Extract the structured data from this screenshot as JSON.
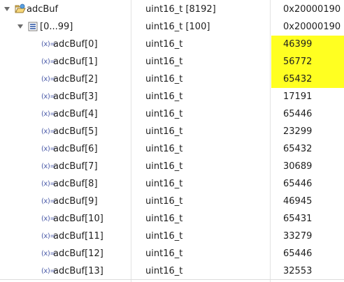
{
  "root": {
    "name": "adcBuf",
    "type": "uint16_t [8192]",
    "value": "0x20000190 <"
  },
  "group": {
    "name": "[0...99]",
    "type": "uint16_t [100]",
    "value": "0x20000190 <"
  },
  "elements": [
    {
      "name": "adcBuf[0]",
      "type": "uint16_t",
      "value": "46399",
      "changed": true
    },
    {
      "name": "adcBuf[1]",
      "type": "uint16_t",
      "value": "56772",
      "changed": true
    },
    {
      "name": "adcBuf[2]",
      "type": "uint16_t",
      "value": "65432",
      "changed": true
    },
    {
      "name": "adcBuf[3]",
      "type": "uint16_t",
      "value": "17191",
      "changed": false
    },
    {
      "name": "adcBuf[4]",
      "type": "uint16_t",
      "value": "65446",
      "changed": false
    },
    {
      "name": "adcBuf[5]",
      "type": "uint16_t",
      "value": "23299",
      "changed": false
    },
    {
      "name": "adcBuf[6]",
      "type": "uint16_t",
      "value": "65432",
      "changed": false
    },
    {
      "name": "adcBuf[7]",
      "type": "uint16_t",
      "value": "30689",
      "changed": false
    },
    {
      "name": "adcBuf[8]",
      "type": "uint16_t",
      "value": "65446",
      "changed": false
    },
    {
      "name": "adcBuf[9]",
      "type": "uint16_t",
      "value": "46945",
      "changed": false
    },
    {
      "name": "adcBuf[10]",
      "type": "uint16_t",
      "value": "65431",
      "changed": false
    },
    {
      "name": "adcBuf[11]",
      "type": "uint16_t",
      "value": "33279",
      "changed": false
    },
    {
      "name": "adcBuf[12]",
      "type": "uint16_t",
      "value": "65446",
      "changed": false
    },
    {
      "name": "adcBuf[13]",
      "type": "uint16_t",
      "value": "32553",
      "changed": false
    }
  ],
  "icons": {
    "root": "struct-pointer-icon",
    "group": "array-range-icon",
    "element": "variable-icon",
    "element_glyph": "(x)="
  },
  "colors": {
    "changed_highlight": "#ffff21"
  }
}
